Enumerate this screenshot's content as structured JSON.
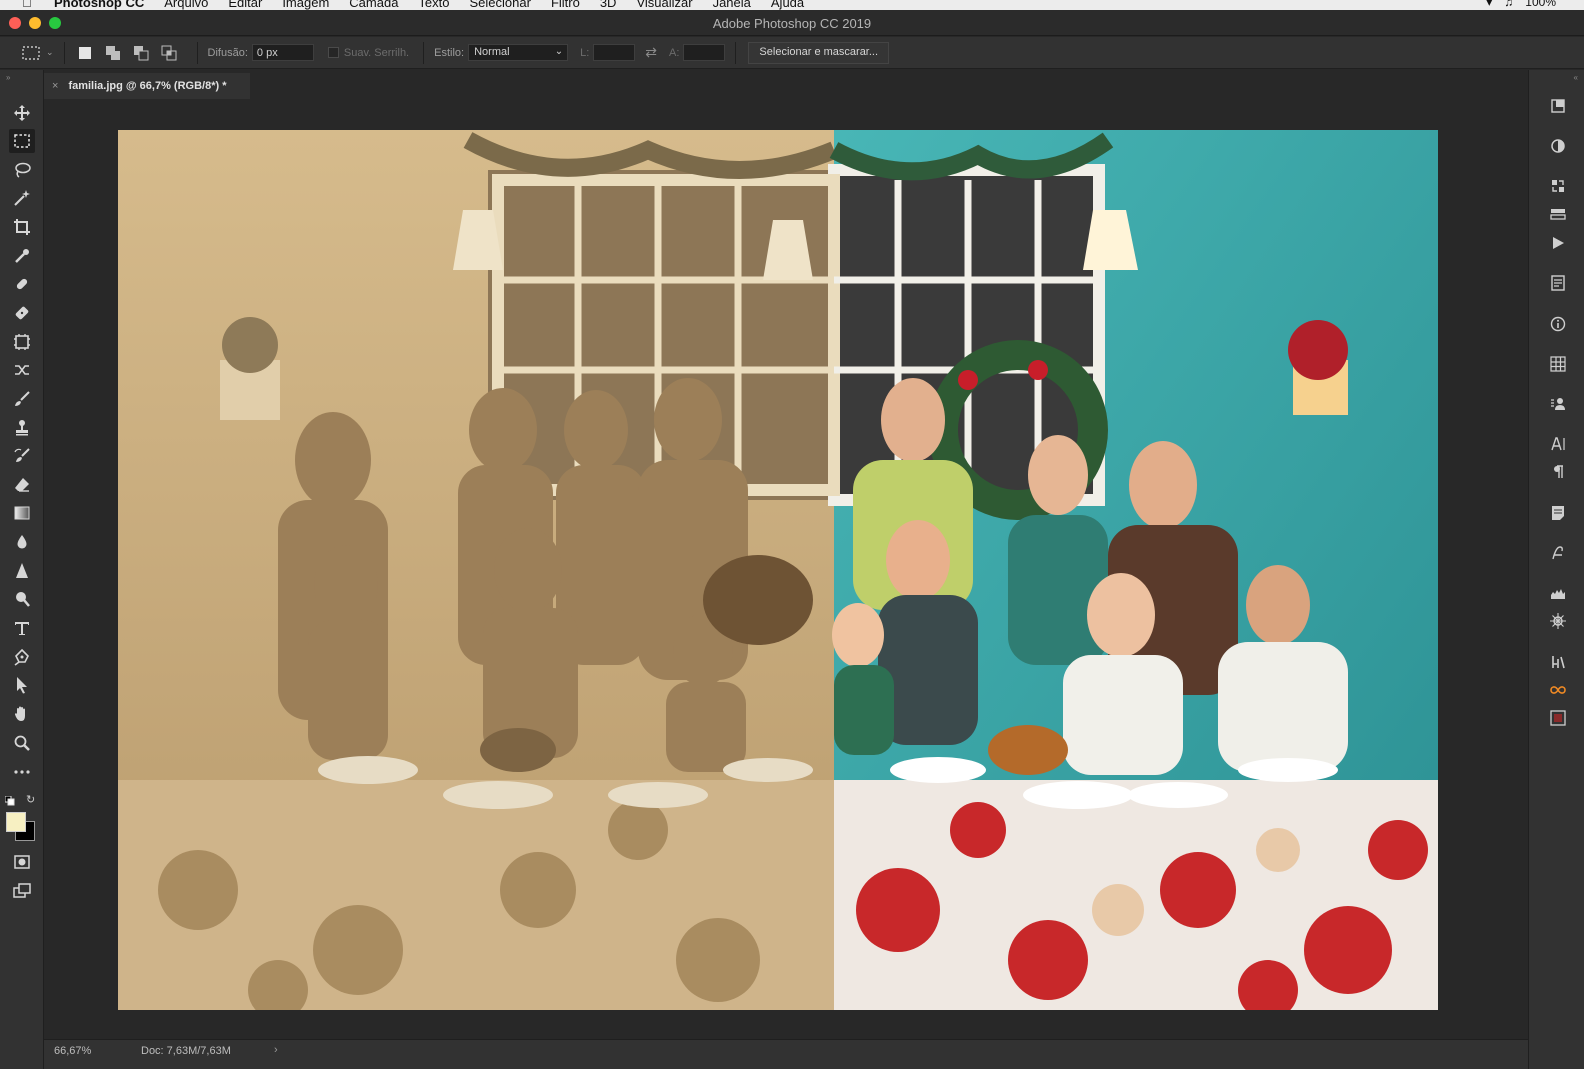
{
  "menubar": {
    "app_name": "Photoshop CC",
    "items": [
      "Arquivo",
      "Editar",
      "Imagem",
      "Camada",
      "Texto",
      "Selecionar",
      "Filtro",
      "3D",
      "Visualizar",
      "Janela",
      "Ajuda"
    ],
    "battery": "100%"
  },
  "window": {
    "title": "Adobe Photoshop CC 2019"
  },
  "options_bar": {
    "feather_label": "Difusão:",
    "feather_value": "0 px",
    "antialias_label": "Suav. Serrilh.",
    "style_label": "Estilo:",
    "style_value": "Normal",
    "width_label": "L:",
    "height_label": "A:",
    "select_mask_label": "Selecionar e mascarar..."
  },
  "document": {
    "tab_title": "familia.jpg @ 66,7% (RGB/8*) *"
  },
  "status": {
    "zoom": "66,67%",
    "doc_size": "Doc: 7,63M/7,63M"
  },
  "colors": {
    "foreground": "#f7f0c2",
    "background": "#000000",
    "sepia": "#c4a679",
    "wall_teal": "#3aa7a9",
    "tablecloth_red": "#c8282a"
  },
  "tools": [
    "move-icon",
    "marquee-icon",
    "lasso-icon",
    "magic-wand-icon",
    "crop-icon",
    "eyedropper-icon",
    "healing-icon",
    "patch-icon",
    "frame-icon",
    "shuffle-icon",
    "brush-icon",
    "stamp-icon",
    "history-brush-icon",
    "eraser-icon",
    "gradient-icon",
    "drop-icon",
    "sharpen-icon",
    "dodge-icon",
    "type-icon",
    "pen-icon",
    "path-select-icon",
    "hand-icon",
    "zoom-icon",
    "more-icon"
  ]
}
